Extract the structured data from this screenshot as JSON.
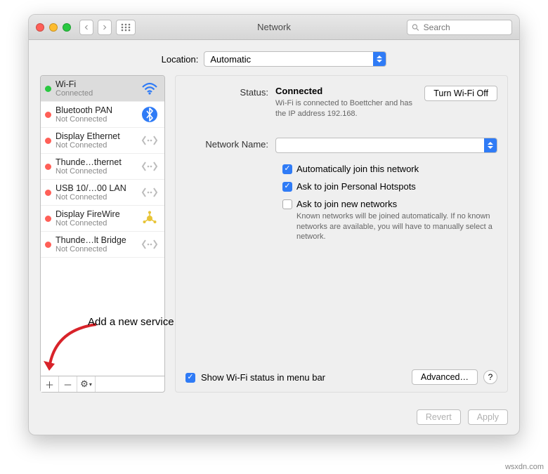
{
  "window": {
    "title": "Network"
  },
  "search": {
    "placeholder": "Search"
  },
  "location": {
    "label": "Location:",
    "value": "Automatic"
  },
  "services": [
    {
      "name": "Wi-Fi",
      "status": "Connected",
      "dot": "green",
      "icon": "wifi",
      "selected": true
    },
    {
      "name": "Bluetooth PAN",
      "status": "Not Connected",
      "dot": "red",
      "icon": "bluetooth"
    },
    {
      "name": "Display Ethernet",
      "status": "Not Connected",
      "dot": "red",
      "icon": "ethernet"
    },
    {
      "name": "Thunde…thernet",
      "status": "Not Connected",
      "dot": "red",
      "icon": "ethernet"
    },
    {
      "name": "USB 10/…00 LAN",
      "status": "Not Connected",
      "dot": "red",
      "icon": "ethernet"
    },
    {
      "name": "Display FireWire",
      "status": "Not Connected",
      "dot": "red",
      "icon": "firewire"
    },
    {
      "name": "Thunde…lt Bridge",
      "status": "Not Connected",
      "dot": "red",
      "icon": "ethernet"
    }
  ],
  "detail": {
    "status_label": "Status:",
    "status_value": "Connected",
    "turn_off": "Turn Wi-Fi Off",
    "status_sub": "Wi-Fi is connected to Boettcher and has the IP address 192.168.",
    "name_label": "Network Name:",
    "name_value": "",
    "auto_join": "Automatically join this network",
    "personal_hotspots": "Ask to join Personal Hotspots",
    "ask_new": "Ask to join new networks",
    "ask_new_sub": "Known networks will be joined automatically. If no known networks are available, you will have to manually select a network.",
    "show_menu": "Show Wi-Fi status in menu bar",
    "advanced": "Advanced…"
  },
  "footer": {
    "revert": "Revert",
    "apply": "Apply"
  },
  "annotation": "Add a new service",
  "credit": "wsxdn.com"
}
